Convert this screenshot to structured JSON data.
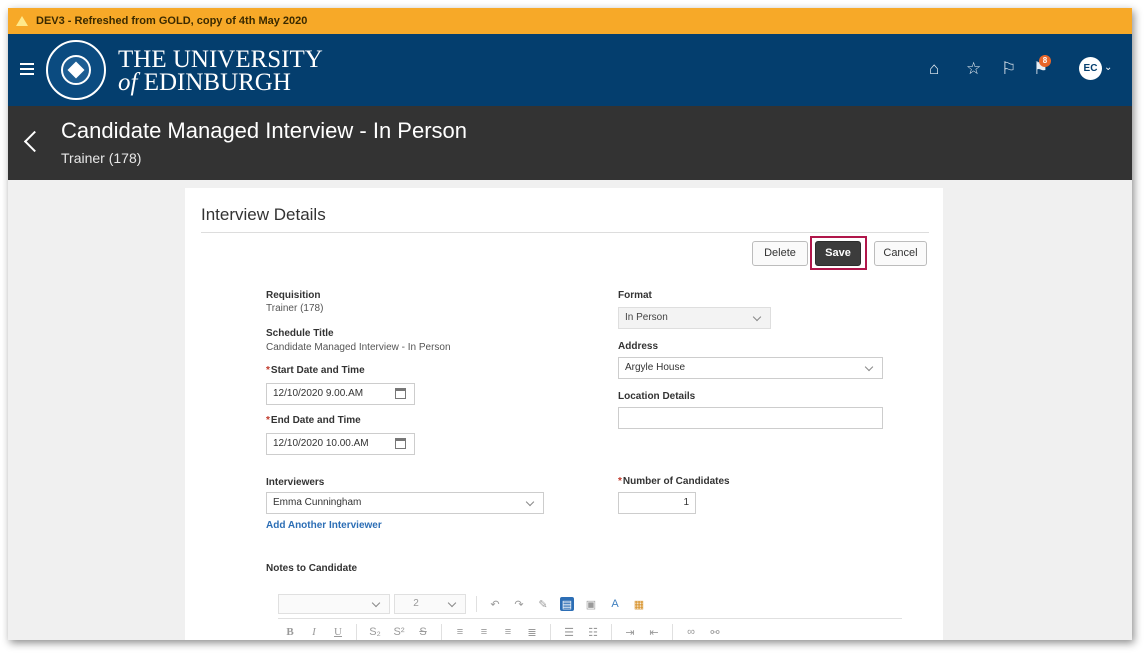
{
  "banner": {
    "text": "DEV3 - Refreshed from GOLD, copy of 4th May 2020"
  },
  "header": {
    "brand_line1": "THE UNIVERSITY",
    "brand_line2_prefix": "of",
    "brand_line2_rest": "EDINBURGH",
    "notification_count": "8",
    "user_initials": "EC",
    "icons": [
      "menu-icon",
      "home-icon",
      "star-icon",
      "flag-icon",
      "notifications-icon",
      "avatar"
    ]
  },
  "titlebar": {
    "title": "Candidate Managed Interview - In Person",
    "subtitle": "Trainer (178)"
  },
  "panel": {
    "title": "Interview Details",
    "buttons": {
      "delete": "Delete",
      "save": "Save",
      "cancel": "Cancel"
    },
    "requisition_label": "Requisition",
    "requisition_value": "Trainer (178)",
    "schedule_title_label": "Schedule Title",
    "schedule_title_value": "Candidate Managed Interview - In Person",
    "start_label": "Start Date and Time",
    "start_value": "12/10/2020 9.00.AM",
    "end_label": "End Date and Time",
    "end_value": "12/10/2020 10.00.AM",
    "format_label": "Format",
    "format_value": "In Person",
    "address_label": "Address",
    "address_value": "Argyle House",
    "location_label": "Location Details",
    "location_value": "",
    "interviewers_label": "Interviewers",
    "interviewer_value": "Emma Cunningham",
    "add_interviewer": "Add Another Interviewer",
    "num_candidates_label": "Number of Candidates",
    "num_candidates_value": "1",
    "notes_label": "Notes to Candidate",
    "editor_font_size": "2"
  },
  "colors": {
    "banner": "#f7a928",
    "header": "#043e6e",
    "titlebar": "#333333",
    "save_highlight": "#b0164a",
    "link": "#2c6eb5"
  }
}
